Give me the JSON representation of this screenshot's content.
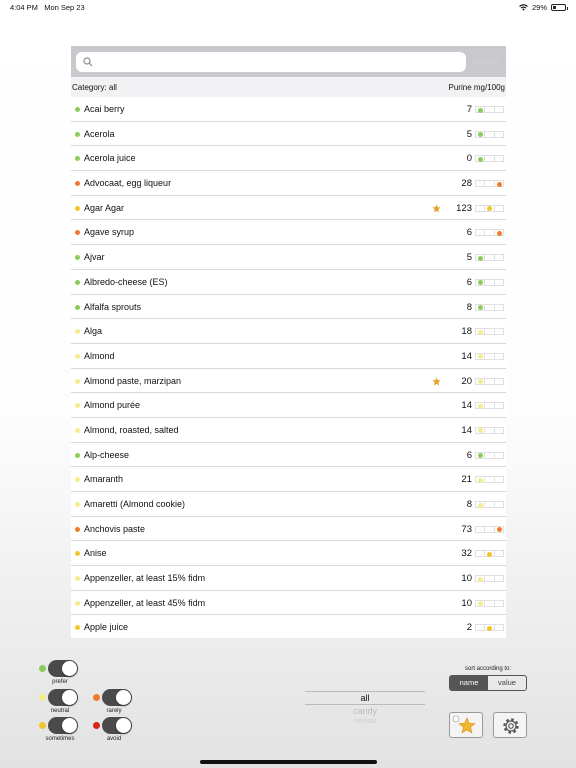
{
  "status": {
    "time": "4:04 PM",
    "date": "Mon Sep 23",
    "battery": "29%",
    "battery_level": 0.29
  },
  "search": {
    "placeholder": "",
    "value": "",
    "cancel_label": "Cancel"
  },
  "header": {
    "category_label": "Category: all",
    "unit_label": "Purine mg/100g"
  },
  "colors": {
    "green": "#8ccc5a",
    "yellow_light": "#f5ec8c",
    "yellow": "#f2c52a",
    "orange": "#f07b2c",
    "red": "#d9241c",
    "star": "#e5a12c"
  },
  "foods": [
    {
      "name": "Acai berry",
      "value": "7",
      "level": 1,
      "color": "green",
      "star": false
    },
    {
      "name": "Acerola",
      "value": "5",
      "level": 1,
      "color": "green",
      "star": false
    },
    {
      "name": "Acerola juice",
      "value": "0",
      "level": 1,
      "color": "green",
      "star": false
    },
    {
      "name": "Advocaat, egg liqueur",
      "value": "28",
      "level": 3,
      "color": "orange",
      "star": false
    },
    {
      "name": "Agar Agar",
      "value": "123",
      "level": 2,
      "color": "yellow",
      "star": true
    },
    {
      "name": "Agave syrup",
      "value": "6",
      "level": 3,
      "color": "orange",
      "star": false
    },
    {
      "name": "Ajvar",
      "value": "5",
      "level": 1,
      "color": "green",
      "star": false
    },
    {
      "name": "Albredo-cheese (ES)",
      "value": "6",
      "level": 1,
      "color": "green",
      "star": false
    },
    {
      "name": "Alfalfa sprouts",
      "value": "8",
      "level": 1,
      "color": "green",
      "star": false
    },
    {
      "name": "Alga",
      "value": "18",
      "level": 1,
      "color": "yellow_light",
      "star": false
    },
    {
      "name": "Almond",
      "value": "14",
      "level": 1,
      "color": "yellow_light",
      "star": false
    },
    {
      "name": "Almond paste, marzipan",
      "value": "20",
      "level": 1,
      "color": "yellow_light",
      "star": true
    },
    {
      "name": "Almond purée",
      "value": "14",
      "level": 1,
      "color": "yellow_light",
      "star": false
    },
    {
      "name": "Almond, roasted, salted",
      "value": "14",
      "level": 1,
      "color": "yellow_light",
      "star": false
    },
    {
      "name": "Alp-cheese",
      "value": "6",
      "level": 1,
      "color": "green",
      "star": false
    },
    {
      "name": "Amaranth",
      "value": "21",
      "level": 1,
      "color": "yellow_light",
      "star": false
    },
    {
      "name": "Amaretti (Almond cookie)",
      "value": "8",
      "level": 1,
      "color": "yellow_light",
      "star": false
    },
    {
      "name": "Anchovis paste",
      "value": "73",
      "level": 3,
      "color": "orange",
      "star": false
    },
    {
      "name": "Anise",
      "value": "32",
      "level": 2,
      "color": "yellow",
      "star": false
    },
    {
      "name": "Appenzeller, at least 15% fidm",
      "value": "10",
      "level": 1,
      "color": "yellow_light",
      "star": false
    },
    {
      "name": "Appenzeller, at least 45% fidm",
      "value": "10",
      "level": 1,
      "color": "yellow_light",
      "star": false
    },
    {
      "name": "Apple juice",
      "value": "2",
      "level": 2,
      "color": "yellow",
      "star": false
    }
  ],
  "filters": [
    {
      "label": "prefer",
      "color": "green",
      "on": true
    },
    {
      "label": "neutral",
      "color": "yellow_light",
      "on": true
    },
    {
      "label": "rarely",
      "color": "orange",
      "on": true
    },
    {
      "label": "sometimes",
      "color": "yellow",
      "on": true
    },
    {
      "label": "avoid",
      "color": "red",
      "on": true
    }
  ],
  "category_picker": {
    "selected": "all",
    "next": "candy",
    "after": "cereals"
  },
  "sort": {
    "label": "sort according to:",
    "options": [
      "name",
      "value"
    ],
    "selected": "name"
  },
  "buttons": {
    "favorites_icon": "star-icon",
    "settings_icon": "gear-icon"
  }
}
